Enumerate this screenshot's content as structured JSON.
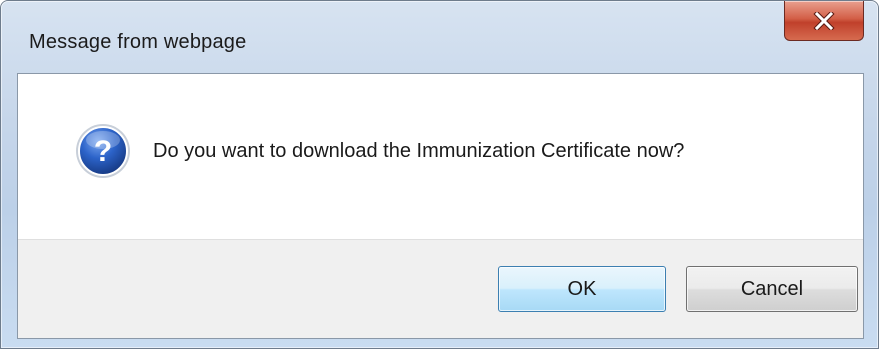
{
  "dialog": {
    "title": "Message from webpage",
    "close_icon": "close-icon",
    "message_icon": "question-icon",
    "message": "Do you want to download the Immunization Certificate now?",
    "ok_label": "OK",
    "cancel_label": "Cancel"
  }
}
